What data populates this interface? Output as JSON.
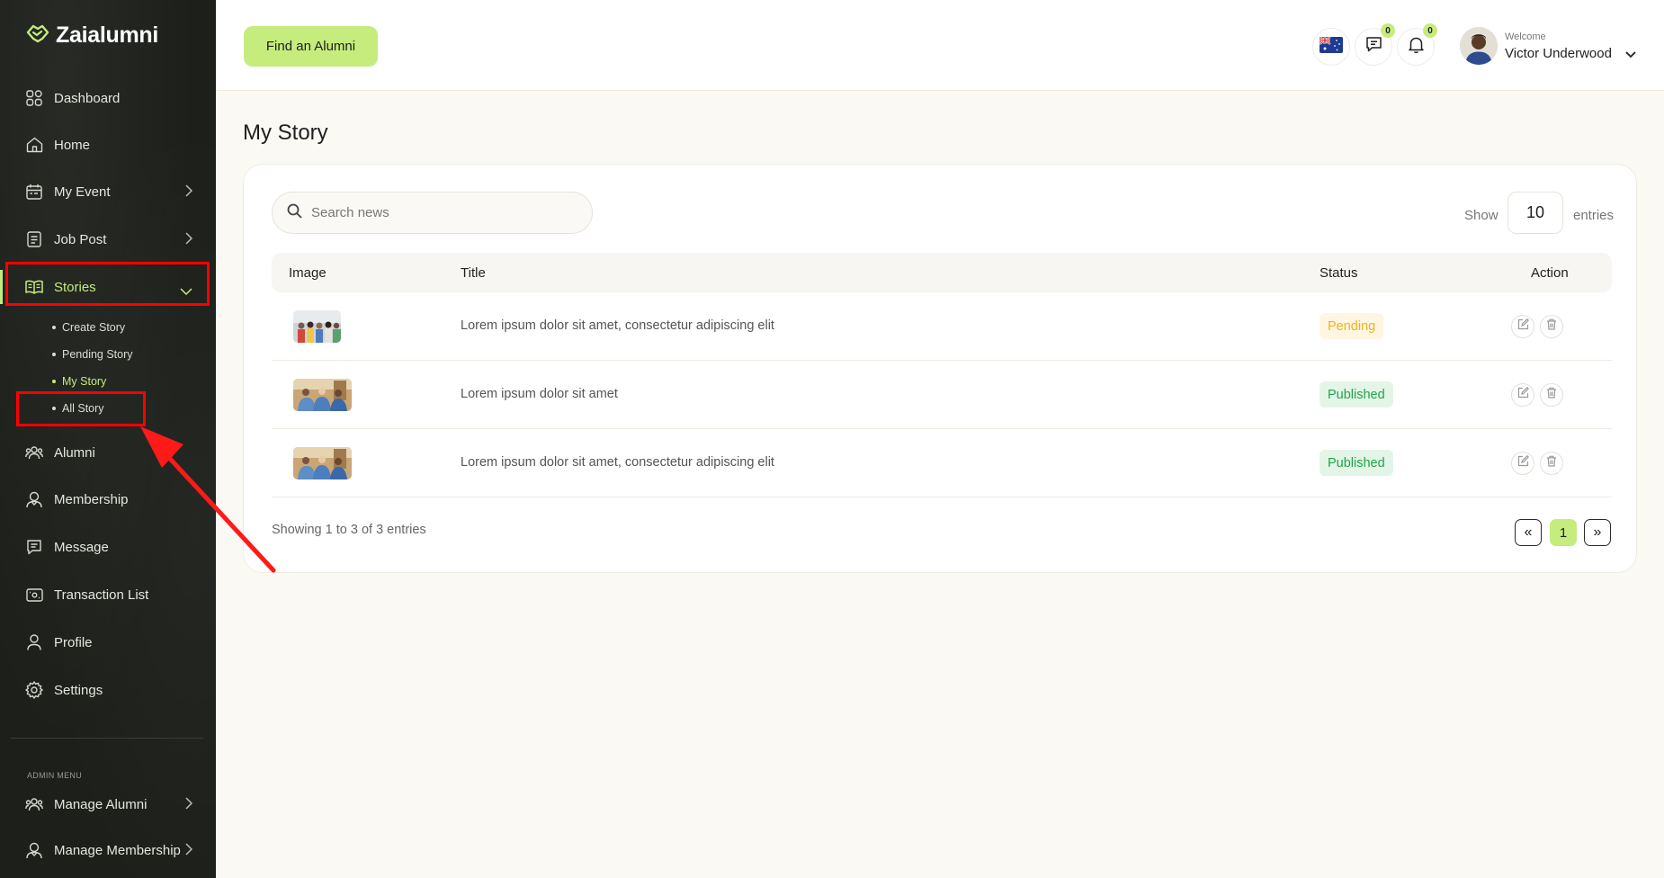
{
  "app": {
    "name": "Zaialumni"
  },
  "sidebar": {
    "items": [
      {
        "label": "Dashboard"
      },
      {
        "label": "Home"
      },
      {
        "label": "My Event"
      },
      {
        "label": "Job Post"
      },
      {
        "label": "Stories"
      },
      {
        "label": "Alumni"
      },
      {
        "label": "Membership"
      },
      {
        "label": "Message"
      },
      {
        "label": "Transaction List"
      },
      {
        "label": "Profile"
      },
      {
        "label": "Settings"
      }
    ],
    "stories_sub": [
      {
        "label": "Create Story"
      },
      {
        "label": "Pending Story"
      },
      {
        "label": "My Story"
      },
      {
        "label": "All Story"
      }
    ],
    "admin_label": "ADMIN MENU",
    "admin_items": [
      {
        "label": "Manage Alumni"
      },
      {
        "label": "Manage Membership"
      }
    ]
  },
  "header": {
    "find_button": "Find an Alumni",
    "messages_count": "0",
    "notifications_count": "0",
    "welcome": "Welcome",
    "user_name": "Victor Underwood"
  },
  "main": {
    "title": "My Story",
    "search_placeholder": "Search news",
    "show_label": "Show",
    "show_value": "10",
    "entries_label": "entries",
    "columns": [
      "Image",
      "Title",
      "Status",
      "Action"
    ],
    "rows": [
      {
        "title": "Lorem ipsum dolor sit amet, consectetur adipiscing elit",
        "status": "Pending"
      },
      {
        "title": "Lorem ipsum dolor sit amet",
        "status": "Published"
      },
      {
        "title": "Lorem ipsum dolor sit amet, consectetur adipiscing elit",
        "status": "Published"
      }
    ],
    "showing": "Showing 1 to 3 of 3 entries",
    "pagination": {
      "prev": "«",
      "current": "1",
      "next": "»"
    }
  },
  "colors": {
    "accent": "#c5ec7c",
    "sidebar_bg": "#1d1f1b",
    "highlight": "#ff0000"
  }
}
